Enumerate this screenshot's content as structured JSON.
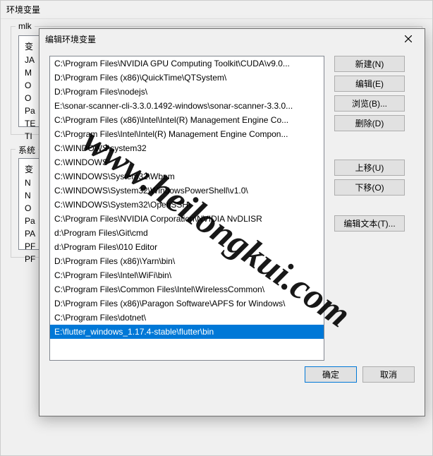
{
  "outer": {
    "title": "环境变量",
    "group_user_label": "mlk",
    "group_sys_label": "系统",
    "var_rows_user": [
      "变",
      "JA",
      "M",
      "O",
      "O",
      "Pa",
      "TE",
      "TI"
    ],
    "var_rows_sys": [
      "变",
      "N",
      "N",
      "O",
      "Pa",
      "PA",
      "PF",
      "PF"
    ],
    "ok": "确定",
    "cancel": "取消"
  },
  "modal": {
    "title": "编辑环境变量",
    "items": [
      "C:\\Program Files\\NVIDIA GPU Computing Toolkit\\CUDA\\v9.0...",
      "D:\\Program Files (x86)\\QuickTime\\QTSystem\\",
      "D:\\Program Files\\nodejs\\",
      "E:\\sonar-scanner-cli-3.3.0.1492-windows\\sonar-scanner-3.3.0...",
      "C:\\Program Files (x86)\\Intel\\Intel(R) Management Engine Co...",
      "C:\\Program Files\\Intel\\Intel(R) Management Engine Compon...",
      "C:\\WINDOWS\\system32",
      "C:\\WINDOWS",
      "C:\\WINDOWS\\System32\\Wbem",
      "C:\\WINDOWS\\System32\\WindowsPowerShell\\v1.0\\",
      "C:\\WINDOWS\\System32\\OpenSSH\\",
      "C:\\Program Files\\NVIDIA Corporation\\NVIDIA NvDLISR",
      "d:\\Program Files\\Git\\cmd",
      "d:\\Program Files\\010 Editor",
      "D:\\Program Files (x86)\\Yarn\\bin\\",
      "C:\\Program Files\\Intel\\WiFi\\bin\\",
      "C:\\Program Files\\Common Files\\Intel\\WirelessCommon\\",
      "D:\\Program Files (x86)\\Paragon Software\\APFS for Windows\\",
      "C:\\Program Files\\dotnet\\",
      "E:\\flutter_windows_1.17.4-stable\\flutter\\bin"
    ],
    "selected_index": 19,
    "buttons": {
      "new": "新建(N)",
      "edit": "编辑(E)",
      "browse": "浏览(B)...",
      "delete": "删除(D)",
      "move_up": "上移(U)",
      "move_down": "下移(O)",
      "edit_text": "编辑文本(T)...",
      "ok": "确定",
      "cancel": "取消"
    }
  },
  "watermark": "www.heilongkui.com"
}
